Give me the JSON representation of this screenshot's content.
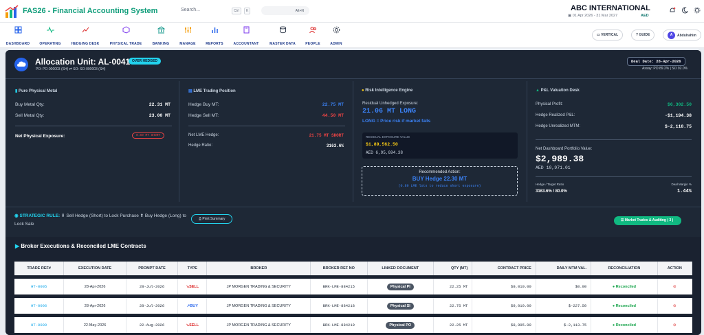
{
  "app": {
    "title": "FAS26 - Financial Accounting System"
  },
  "search": {
    "placeholder": "Search...",
    "kbd1": "Ctrl",
    "kbd2": "K",
    "shortcut": "Alt+N"
  },
  "company": {
    "name": "ABC INTERNATIONAL",
    "fy": "01 Apr 2026 - 31 Mar 2027",
    "currency": "AED"
  },
  "nav": [
    "DASHBOARD",
    "OPERATING",
    "HEDGING DESK",
    "PHYSICAL TRADE",
    "BANKING",
    "MANAGE",
    "REPORTS",
    "ACCOUNTANT",
    "MASTER DATA",
    "PEOPLE",
    "ADMIN"
  ],
  "toolbar": {
    "vertical": "VERTICAL",
    "guide": "GUIDE",
    "user_initial": "A",
    "user": "Abdulrahim"
  },
  "unit": {
    "title": "Allocation Unit: AL-0041",
    "status": "OVER HEDGED",
    "po": "PO: PO-000003 (SH) ⇄ SO: SO-000003 (SH)",
    "deal_date": "Deal Date: 28-Apr-2026",
    "assay": "Assay: PO 89.2% | SO 92.0%"
  },
  "physical": {
    "title": "Pure Physical Metal",
    "buy_label": "Buy Metal Qty:",
    "buy_value": "22.31 MT",
    "sell_label": "Sell Metal Qty:",
    "sell_value": "23.00 MT",
    "net_label": "Net Physical Exposure:",
    "net_value": "0.69 MT SHORT"
  },
  "lme": {
    "title": "LME Trading Position",
    "hbuy_label": "Hedge Buy MT:",
    "hbuy_value": "22.75 MT",
    "hsell_label": "Hedge Sell MT:",
    "hsell_value": "44.50 MT",
    "net_label": "Net LME Hedge:",
    "net_value": "21.75 MT SHORT",
    "ratio_label": "Hedge Ratio:",
    "ratio_value": "3163.6%"
  },
  "risk": {
    "title": "Risk Intelligence Engine",
    "residual_label": "Residual Unhedged Exposure:",
    "residual_value": "21.06 MT LONG",
    "note": "LONG = Price risk if market falls",
    "exp_label": "RESIDUAL EXPOSURE VALUE",
    "exp_usd": "$1,89,562.50",
    "exp_aed": "AED 6,95,694.38",
    "rec_label": "Recommended Action:",
    "rec_action": "BUY Hedge 22.30 MT",
    "rec_note": "(0.89 LME lots to reduce short exposure)"
  },
  "pnl": {
    "title": "P&L Valuation Desk",
    "phys_label": "Physical Profit:",
    "phys_value": "$6,302.50",
    "real_label": "Hedge Realized P&L:",
    "real_value": "-$1,194.38",
    "unreal_label": "Hedge Unrealized MTM:",
    "unreal_value": "$-2,118.75",
    "net_label": "Net Dashboard Portfolio Value:",
    "net_value": "$2,989.38",
    "net_aed": "AED 10,971.01",
    "ratio_label": "Hedge / Target Ratio",
    "ratio_value": "3163.6% / 80.0%",
    "margin_label": "Deal Margin %",
    "margin_value": "1.44%"
  },
  "strategic": {
    "label": "STRATEGIC RULE:",
    "rule1": "Sell Hedge (Short) to Lock Purchase",
    "rule2": "Buy Hedge (Long) to Lock Sale",
    "print": "Print Summary",
    "market": "Market Trades & Auditing ( 3 )"
  },
  "broker": {
    "title": "Broker Executions & Reconciled LME Contracts",
    "headers": [
      "TRADE REF#",
      "EXECUTION DATE",
      "PROMPT DATE",
      "TYPE",
      "BROKER",
      "BROKER REF NO",
      "LINKED DOCUMENT",
      "QTY (MT)",
      "CONTRACT PRICE",
      "DAILY MTM VAL.",
      "RECONCILIATION",
      "ACTION"
    ],
    "rows": [
      {
        "ref": "HT-0005",
        "exec": "28-Apr-2026",
        "prompt": "28-Jul-2026",
        "type": "SELL",
        "broker": "JP MORGEN TRADING & SECURITY",
        "bref": "BRK-LME-884215",
        "doc": "Physical PI",
        "qty": "22.25 MT",
        "price": "$9,010.00",
        "mtm": "$0.00",
        "rec": "Reconciled"
      },
      {
        "ref": "HT-0006",
        "exec": "28-Apr-2026",
        "prompt": "28-Jul-2026",
        "type": "BUY",
        "broker": "JP MORGEN TRADING & SECURITY",
        "bref": "BRK-LME-884218",
        "doc": "Physical SI",
        "qty": "22.75 MT",
        "price": "$9,010.00",
        "mtm": "$-227.50",
        "rec": "Reconciled"
      },
      {
        "ref": "HT-0009",
        "exec": "22-May-2026",
        "prompt": "22-Aug-2026",
        "type": "SELL",
        "broker": "JP MORGEN TRADING & SECURITY",
        "bref": "BRK-LME-884219",
        "doc": "Physical PO",
        "qty": "22.25 MT",
        "price": "$8,905.00",
        "mtm": "$-2,113.75",
        "rec": "Reconciled"
      }
    ]
  },
  "colors": {
    "accent": "#0f9d7a",
    "panel": "#1e2836",
    "danger": "#ef4444",
    "info": "#3b82f6",
    "success": "#10b981"
  }
}
